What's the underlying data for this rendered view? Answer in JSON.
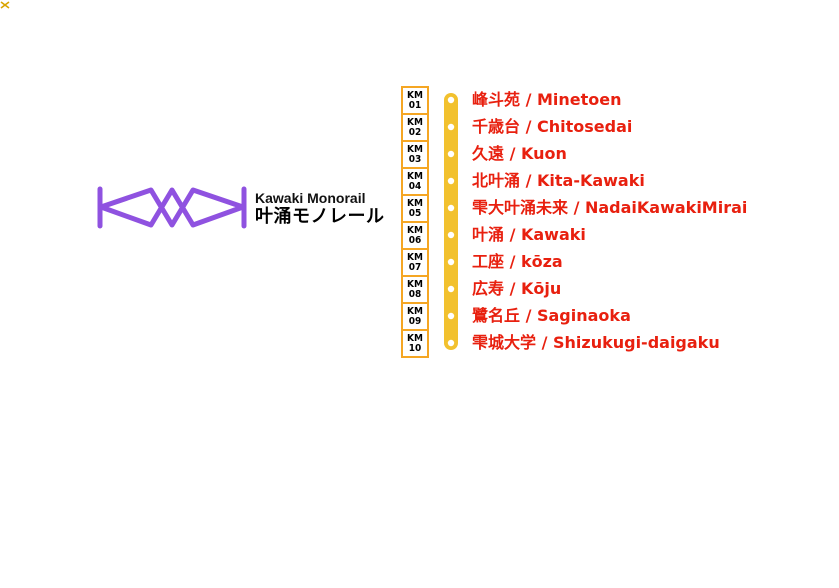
{
  "colors": {
    "logo": "#8f52e0",
    "route": "#f2c12e",
    "code_border": "#f5a623",
    "station_text": "#e8200f"
  },
  "line": {
    "name_en": "Kawaki Monorail",
    "name_ja": "叶涌モノレール"
  },
  "stations": [
    {
      "prefix": "KM",
      "number": "01",
      "name": "峰斗苑 / Minetoen"
    },
    {
      "prefix": "KM",
      "number": "02",
      "name": "千歳台 / Chitosedai"
    },
    {
      "prefix": "KM",
      "number": "03",
      "name": "久遠 / Kuon"
    },
    {
      "prefix": "KM",
      "number": "04",
      "name": "北叶涌 / Kita-Kawaki"
    },
    {
      "prefix": "KM",
      "number": "05",
      "name": "雫大叶涌未来 / NadaiKawakiMirai"
    },
    {
      "prefix": "KM",
      "number": "06",
      "name": "叶涌 / Kawaki"
    },
    {
      "prefix": "KM",
      "number": "07",
      "name": "工座 / kōza"
    },
    {
      "prefix": "KM",
      "number": "08",
      "name": "広寿 / Kōju"
    },
    {
      "prefix": "KM",
      "number": "09",
      "name": "鷺名丘 / Saginaoka"
    },
    {
      "prefix": "KM",
      "number": "10",
      "name": "雫城大学 / Shizukugi-daigaku"
    }
  ]
}
